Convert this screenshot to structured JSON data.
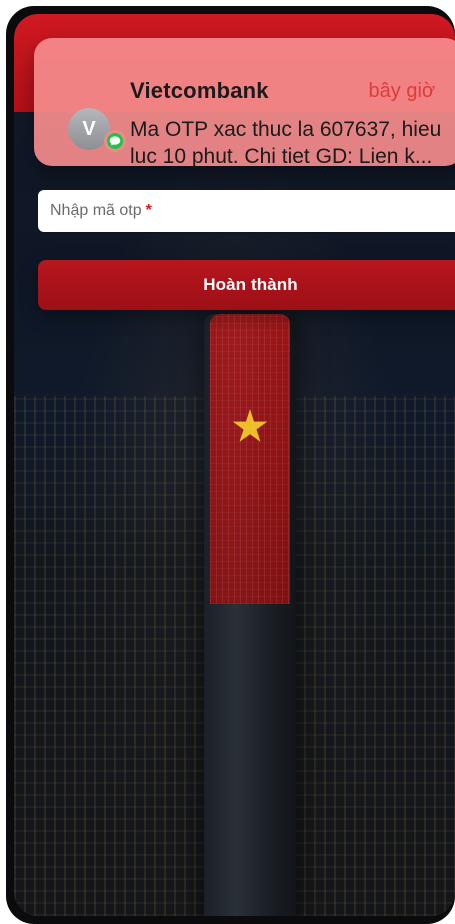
{
  "notification": {
    "app_name": "Vietcombank",
    "time": "bây giờ",
    "avatar_initial": "V",
    "message_line_1": "Ma OTP xac thuc la 607637, hieu",
    "message_line_2": "luc 10 phut. Chi tiet GD: Lien k..."
  },
  "otp": {
    "placeholder_text": "Nhập mã otp",
    "required_mark": "*"
  },
  "actions": {
    "complete_label": "Hoàn thành"
  },
  "theme": {
    "brand_red": "#b8161e",
    "notification_bg": "#f58c8c",
    "badge_green": "#23c14a"
  }
}
